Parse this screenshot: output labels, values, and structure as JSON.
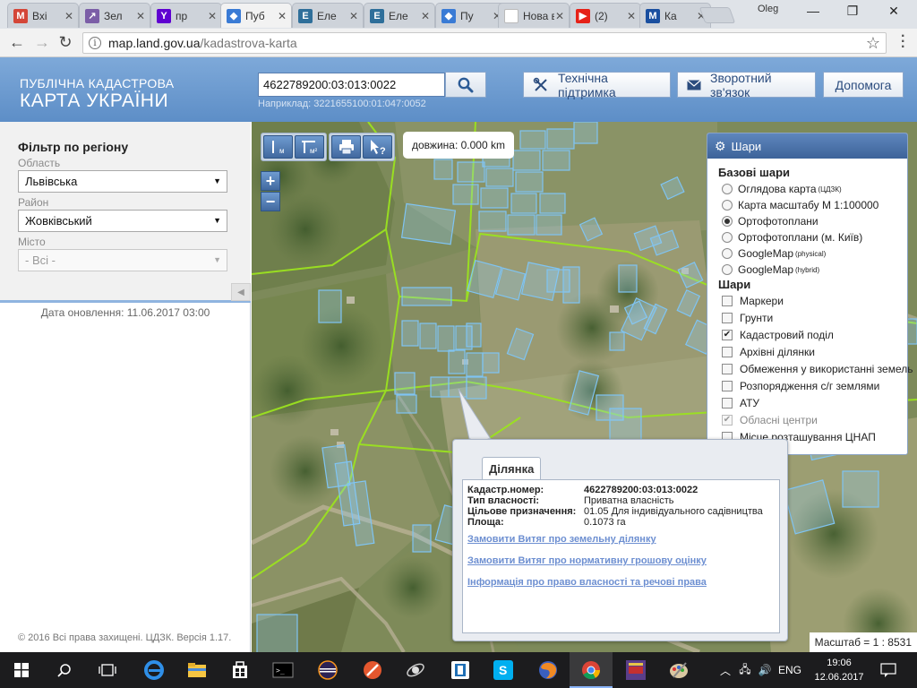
{
  "browser": {
    "tabs": [
      {
        "label": "Вхі",
        "icon": "gmail-icon",
        "color": "#d44638"
      },
      {
        "label": "Зел",
        "icon": "chart-icon",
        "color": "#7b5ea7"
      },
      {
        "label": "пр",
        "icon": "yahoo-icon",
        "color": "#5f01d1"
      },
      {
        "label": "Пуб",
        "icon": "ukraine-map-icon",
        "color": "#3a7bd5"
      },
      {
        "label": "Еле",
        "icon": "e-icon",
        "color": "#2f6f9a"
      },
      {
        "label": "Еле",
        "icon": "e-icon",
        "color": "#2f6f9a"
      },
      {
        "label": "Пу",
        "icon": "ukraine-map-icon",
        "color": "#3a7bd5"
      },
      {
        "label": "Нова в",
        "icon": "blank-icon",
        "color": "#ffffff"
      },
      {
        "label": "(2)",
        "icon": "youtube-icon",
        "color": "#e62117"
      },
      {
        "label": "Ка",
        "icon": "m-icon",
        "color": "#1a4fa0"
      }
    ],
    "profile": "Oleg",
    "url_host": "map.land.gov.ua",
    "url_path": "/kadastrova-karta"
  },
  "header": {
    "brand_line1": "ПУБЛІЧНА КАДАСТРОВА",
    "brand_line2": "КАРТА УКРАЇНИ",
    "search_value": "4622789200:03:013:0022",
    "search_hint": "Наприклад: 3221655100:01:047:0052",
    "buttons": {
      "support": "Технічна підтримка",
      "feedback": "Зворотний зв'язок",
      "help": "Допомога"
    }
  },
  "sidebar": {
    "title": "Фільтр по регіону",
    "oblast_label": "Область",
    "oblast_value": "Львівська",
    "rayon_label": "Район",
    "rayon_value": "Жовківський",
    "city_label": "Місто",
    "city_value": "- Всі -",
    "updated": "Дата оновлення: 11.06.2017 03:00",
    "copyright": "© 2016 Всі права захищені. ЦДЗК. Версія 1.17."
  },
  "map": {
    "measure": "довжина: 0.000 km",
    "zoom_in": "+",
    "zoom_out": "−",
    "scale": "Масштаб = 1 : 8531"
  },
  "layers": {
    "title": "Шари",
    "base_title": "Базові шари",
    "base": [
      {
        "label": "Оглядова карта",
        "sup": "(ЦДЗК)",
        "selected": false
      },
      {
        "label": "Карта масштабу М 1:100000",
        "sup": "",
        "selected": false
      },
      {
        "label": "Ортофотоплани",
        "sup": "",
        "selected": true
      },
      {
        "label": "Ортофотоплани (м. Київ)",
        "sup": "",
        "selected": false
      },
      {
        "label": "GoogleMap",
        "sup": "(physical)",
        "selected": false
      },
      {
        "label": "GoogleMap",
        "sup": "(hybrid)",
        "selected": false
      }
    ],
    "overlay_title": "Шари",
    "overlays": [
      {
        "label": "Маркери",
        "checked": false,
        "disabled": false
      },
      {
        "label": "Грунти",
        "checked": false,
        "disabled": false
      },
      {
        "label": "Кадастровий поділ",
        "checked": true,
        "disabled": false
      },
      {
        "label": "Архівні ділянки",
        "checked": false,
        "disabled": false
      },
      {
        "label": "Обмеження у використанні земель",
        "checked": false,
        "disabled": false
      },
      {
        "label": "Розпорядження с/г землями",
        "checked": false,
        "disabled": false
      },
      {
        "label": "АТУ",
        "checked": false,
        "disabled": false
      },
      {
        "label": "Обласні центри",
        "checked": true,
        "disabled": true
      },
      {
        "label": "Місце розташування ЦНАП",
        "checked": false,
        "disabled": false
      }
    ]
  },
  "parcel": {
    "tab": "Ділянка",
    "rows": [
      {
        "key": "Кадастр.номер:",
        "value": "4622789200:03:013:0022"
      },
      {
        "key": "Тип власності:",
        "value": "Приватна власність"
      },
      {
        "key": "Цільове призначення:",
        "value": "01.05 Для індивідуального садівництва"
      },
      {
        "key": "Площа:",
        "value": "0.1073 га"
      }
    ],
    "links": [
      "Замовити Витяг про земельну ділянку",
      "Замовити Витяг про нормативну грошову оцінку",
      "Інформація про право власності та речові права"
    ]
  },
  "taskbar": {
    "lang": "ENG",
    "time": "19:06",
    "date": "12.06.2017"
  },
  "colors": {
    "header_blue": "#5d8ec7",
    "parcel_outline": "#7fc4f3",
    "boundary_green": "#9be31f",
    "link_blue": "#6d8fd1"
  }
}
